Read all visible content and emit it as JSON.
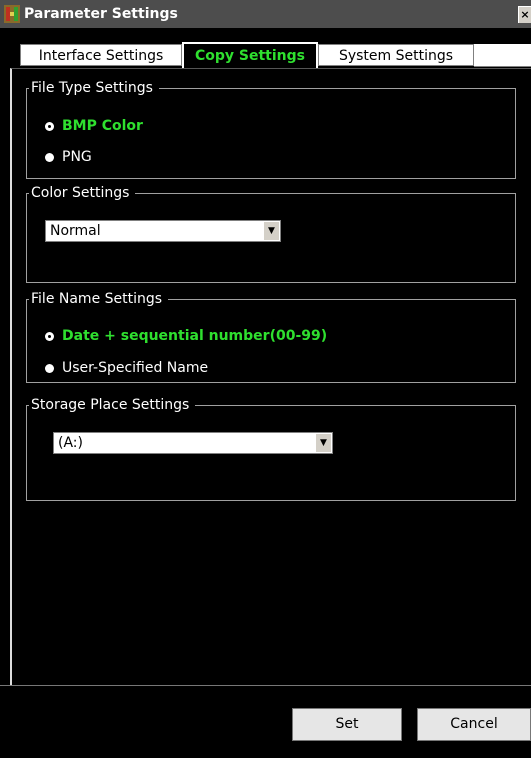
{
  "window": {
    "title": "Parameter Settings",
    "close_label": "×"
  },
  "tabs": [
    {
      "label": "Interface Settings",
      "active": false
    },
    {
      "label": "Copy Settings",
      "active": true
    },
    {
      "label": "System Settings",
      "active": false
    }
  ],
  "file_type": {
    "title": "File Type Settings",
    "options": [
      {
        "label": "BMP Color",
        "selected": true
      },
      {
        "label": "PNG",
        "selected": false
      }
    ]
  },
  "color": {
    "title": "Color Settings",
    "value": "Normal"
  },
  "file_name": {
    "title": "File Name Settings",
    "options": [
      {
        "label": "Date + sequential number(00-99)",
        "selected": true
      },
      {
        "label": "User-Specified Name",
        "selected": false
      }
    ]
  },
  "storage": {
    "title": "Storage Place Settings",
    "value": "(A:)"
  },
  "buttons": {
    "set": "Set",
    "cancel": "Cancel"
  },
  "colors": {
    "accent_green": "#2fe02f",
    "background": "#000000",
    "titlebar": "#4d4d4d"
  }
}
